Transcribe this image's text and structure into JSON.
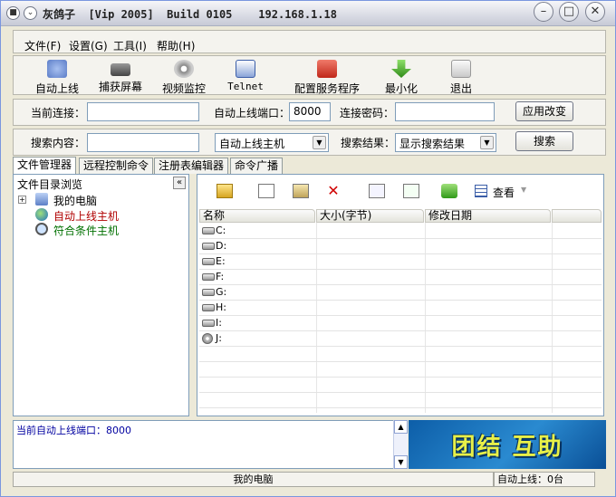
{
  "title": "灰鸽子  [Vip 2005]  Build 0105    192.168.1.18",
  "menu": [
    "文件(F)",
    "设置(G)",
    "工具(I)",
    "帮助(H)"
  ],
  "toolbar": [
    {
      "label": "自动上线",
      "icon": "satellite-icon",
      "color": "#5b7cc7"
    },
    {
      "label": "捕获屏幕",
      "icon": "camera-icon",
      "color": "#555555"
    },
    {
      "label": "视频监控",
      "icon": "webcam-icon",
      "color": "#888888"
    },
    {
      "label": "Telnet",
      "icon": "terminal-icon",
      "color": "#3b5ea8"
    },
    {
      "label": "配置服务程序",
      "icon": "toolbox-icon",
      "color": "#d23a2b"
    },
    {
      "label": "最小化",
      "icon": "minimize-arrow-icon",
      "color": "#4caa2a"
    },
    {
      "label": "退出",
      "icon": "exit-icon",
      "color": "#cfcfcf"
    }
  ],
  "connection": {
    "current_label": "当前连接：",
    "current_value": "",
    "port_label": "自动上线端口：",
    "port_value": "8000",
    "password_label": "连接密码：",
    "password_value": "",
    "apply_button": "应用改变"
  },
  "search": {
    "content_label": "搜索内容：",
    "content_value": "",
    "scope_value": "自动上线主机",
    "result_label": "搜索结果：",
    "result_value": "显示搜索结果",
    "search_button": "搜索"
  },
  "tabs": [
    "文件管理器",
    "远程控制命令",
    "注册表编辑器",
    "命令广播"
  ],
  "tree": {
    "title": "文件目录浏览",
    "items": [
      {
        "label": "我的电脑",
        "color": "#000000"
      },
      {
        "label": "自动上线主机",
        "color": "#b00000"
      },
      {
        "label": "符合条件主机",
        "color": "#007000"
      }
    ]
  },
  "filetoolbar": {
    "view_label": "查看"
  },
  "columns": [
    "名称",
    "大小(字节)",
    "修改日期"
  ],
  "drives": [
    "C:",
    "D:",
    "E:",
    "F:",
    "G:",
    "H:",
    "I:",
    "J:"
  ],
  "log": "当前自动上线端口：8000",
  "banner": "团结 互助",
  "status": {
    "center": "我的电脑",
    "right": "自动上线：0台"
  }
}
